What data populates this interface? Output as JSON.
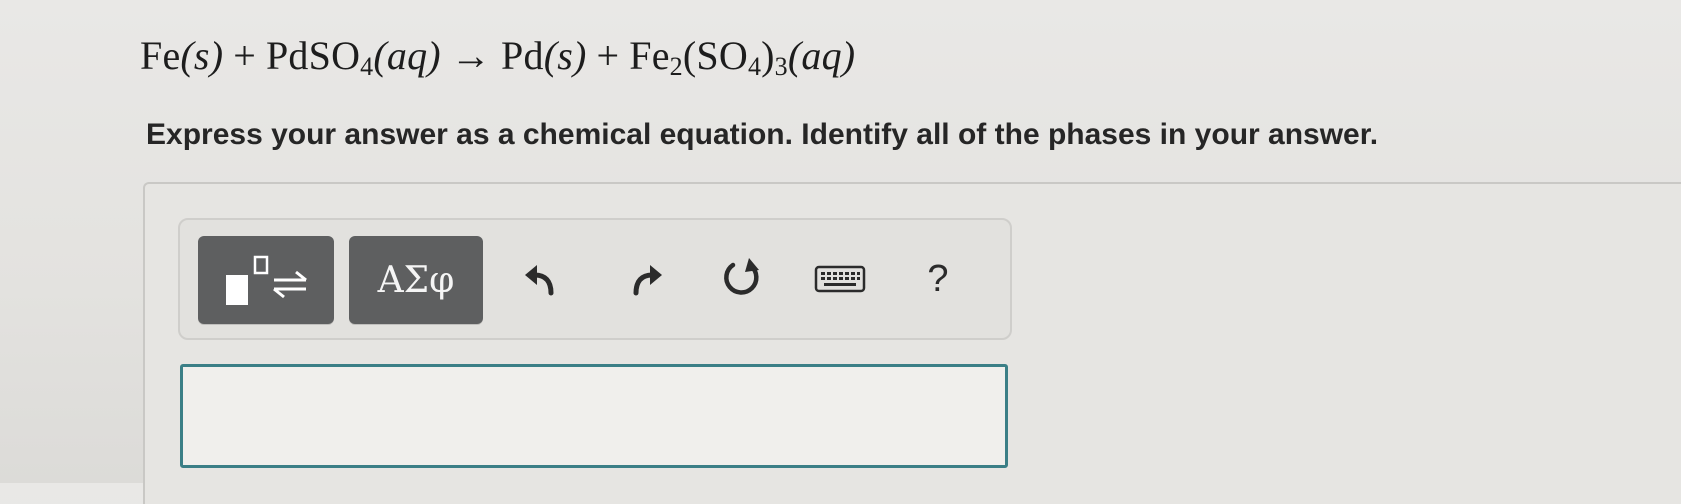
{
  "equation": {
    "fe": "Fe",
    "s1": "(s)",
    "plus1": "+",
    "pdso": "PdSO",
    "sub4a": "4",
    "aq1": "(aq)",
    "arrow": "→",
    "pd": "Pd",
    "s2": "(s)",
    "plus2": "+",
    "fe2": "Fe",
    "sub2": "2",
    "so4open": "(SO",
    "sub4b": "4",
    "close": ")",
    "sub3": "3",
    "aq2": "(aq)"
  },
  "instruction": "Express your answer as a chemical equation. Identify all of the phases in your answer.",
  "toolbar": {
    "templates_icon": "templates-equilibrium-icon",
    "greek_label": "ΑΣφ",
    "undo_icon": "undo-icon",
    "redo_icon": "redo-icon",
    "reset_icon": "reset-icon",
    "keyboard_icon": "keyboard-icon",
    "help_label": "?"
  },
  "answer": {
    "value": ""
  },
  "colors": {
    "button_dark": "#5e5f60",
    "input_border": "#3b7f86",
    "background": "#e6e5e2"
  }
}
